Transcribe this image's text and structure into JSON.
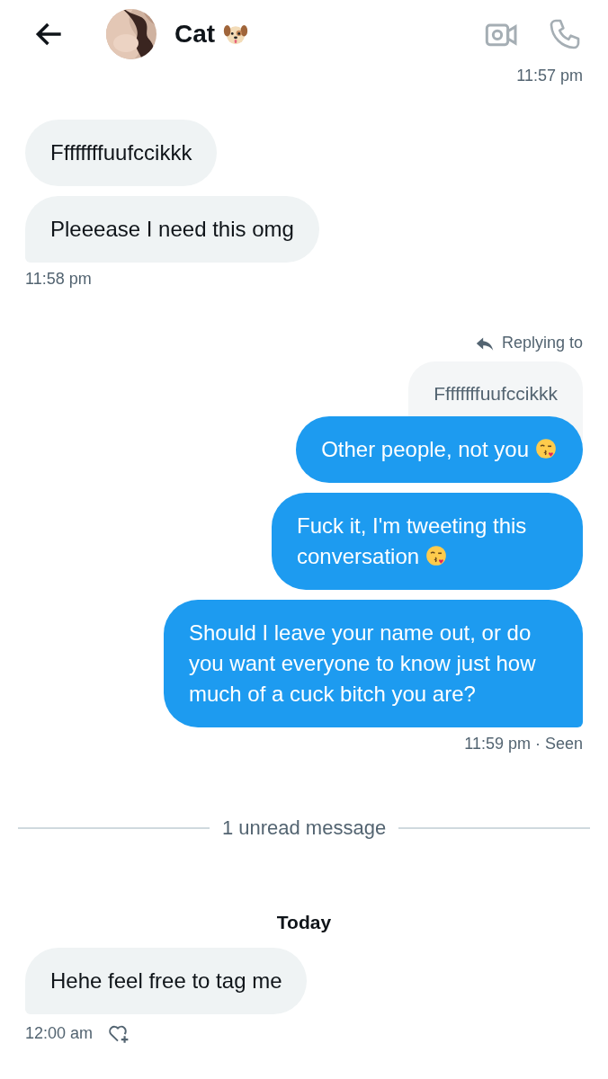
{
  "header": {
    "title": "Cat",
    "dog_emoji": true
  },
  "messages": [
    {
      "kind": "sent-time",
      "text": "11:57 pm"
    },
    {
      "kind": "received",
      "text": "Ffffffffuufccikkk",
      "last": false
    },
    {
      "kind": "received",
      "text": "Pleeease I need this omg",
      "last": true
    },
    {
      "kind": "received-time",
      "text": "11:58 pm"
    },
    {
      "kind": "reply-label",
      "text": "Replying to"
    },
    {
      "kind": "quoted",
      "text": "Ffffffffuufccikkk"
    },
    {
      "kind": "sent",
      "text": "Other people, not you",
      "kiss_emoji": true,
      "last": false
    },
    {
      "kind": "sent",
      "text": "Fuck it, I'm tweeting this conversation",
      "kiss_emoji": true,
      "last": false
    },
    {
      "kind": "sent",
      "text": "Should I leave your name out, or do you want everyone to know just how much of a cuck bitch you are?",
      "last": true
    },
    {
      "kind": "sent-time",
      "text": "11:59 pm · Seen"
    },
    {
      "kind": "divider",
      "text": "1 unread message"
    },
    {
      "kind": "day",
      "text": "Today"
    },
    {
      "kind": "received",
      "text": "Hehe feel free to tag me",
      "last": true
    },
    {
      "kind": "received-time",
      "text": "12:00 am",
      "react": true
    }
  ]
}
